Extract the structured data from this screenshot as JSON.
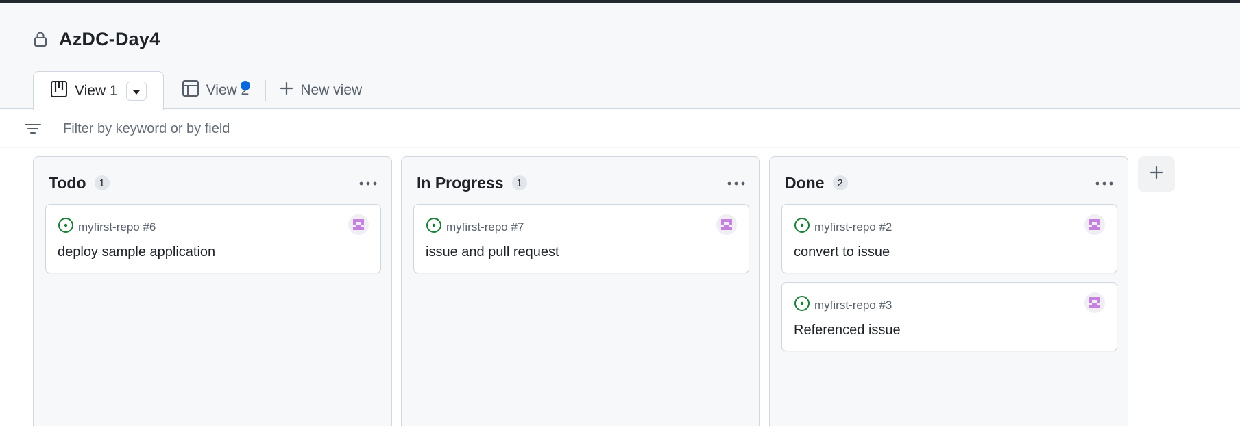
{
  "project": {
    "title": "AzDC-Day4"
  },
  "tabs": [
    {
      "label": "View 1",
      "icon": "board-icon",
      "active": true
    },
    {
      "label": "View 2",
      "icon": "table-icon",
      "active": false,
      "unsaved_dot_color": "#0969da"
    }
  ],
  "new_view_label": "New view",
  "filter": {
    "placeholder": "Filter by keyword or by field",
    "value": ""
  },
  "columns": [
    {
      "title": "Todo",
      "count": "1",
      "cards": [
        {
          "repo": "myfirst-repo #6",
          "title": "deploy sample application",
          "status_icon": "issue-open-icon"
        }
      ]
    },
    {
      "title": "In Progress",
      "count": "1",
      "cards": [
        {
          "repo": "myfirst-repo #7",
          "title": "issue and pull request",
          "status_icon": "issue-open-icon"
        }
      ]
    },
    {
      "title": "Done",
      "count": "2",
      "cards": [
        {
          "repo": "myfirst-repo #2",
          "title": "convert to issue",
          "status_icon": "issue-open-icon"
        },
        {
          "repo": "myfirst-repo #3",
          "title": "Referenced issue",
          "status_icon": "issue-open-icon"
        }
      ]
    }
  ],
  "colors": {
    "issue_open": "#1a7f37",
    "accent": "#0969da",
    "avatar": "#c681e0"
  }
}
